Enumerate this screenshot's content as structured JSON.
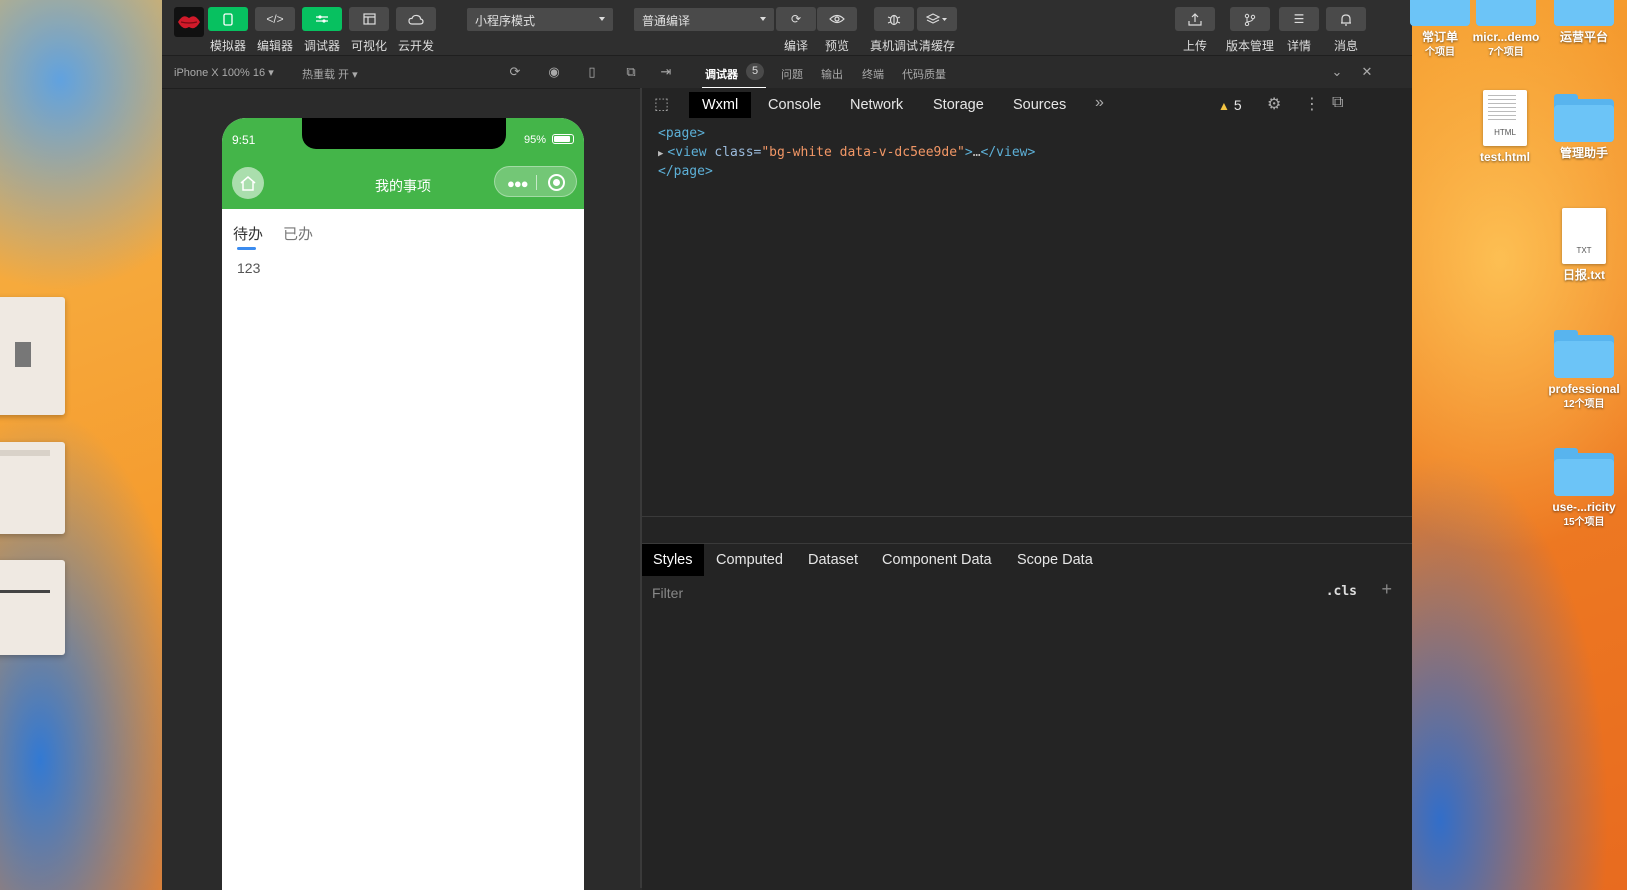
{
  "toolbar": {
    "buttons": [
      {
        "label": "模拟器",
        "icon": "phone-icon"
      },
      {
        "label": "编辑器",
        "icon": "code-icon"
      },
      {
        "label": "调试器",
        "icon": "debug-icon"
      },
      {
        "label": "可视化",
        "icon": "layout-icon"
      },
      {
        "label": "云开发",
        "icon": "cloud-icon"
      }
    ],
    "mode_select": "小程序模式",
    "compile_select": "普通编译",
    "actions": [
      {
        "label": "编译",
        "icon": "refresh-icon"
      },
      {
        "label": "预览",
        "icon": "eye-icon"
      },
      {
        "label": "真机调试",
        "icon": "bug-icon"
      },
      {
        "label": "清缓存",
        "icon": "layers-icon"
      }
    ],
    "right_actions": [
      {
        "label": "上传",
        "icon": "upload-icon"
      },
      {
        "label": "版本管理",
        "icon": "branch-icon"
      },
      {
        "label": "详情",
        "icon": "menu-icon"
      },
      {
        "label": "消息",
        "icon": "bell-icon"
      }
    ]
  },
  "subbar": {
    "device": "iPhone X 100% 16",
    "hot_reload": "热重载 开",
    "tabs": [
      "调试器",
      "问题",
      "输出",
      "终端",
      "代码质量"
    ],
    "debugger_count": "5"
  },
  "phone": {
    "time": "9:51",
    "battery": "95%",
    "title": "我的事项",
    "tabs": [
      "待办",
      "已办"
    ],
    "content": "123"
  },
  "devtools": {
    "tabs": [
      "Wxml",
      "Console",
      "Network",
      "Storage",
      "Sources"
    ],
    "more": "»",
    "warnings": "5",
    "wxml": {
      "open_tag": "<page>",
      "view_open": "<view",
      "attr_name": "class=",
      "attr_value": "\"bg-white data-v-dc5ee9de\"",
      "view_close_bracket": ">",
      "ellipsis": "…",
      "view_close": "</view>",
      "close_tag": "</page>"
    },
    "styles_tabs": [
      "Styles",
      "Computed",
      "Dataset",
      "Component Data",
      "Scope Data"
    ],
    "filter_placeholder": "Filter",
    "cls": ".cls",
    "plus": "+"
  },
  "desktop": {
    "icons": [
      {
        "name": "常订单",
        "sub": "个项目",
        "type": "folder"
      },
      {
        "name": "micr...demo",
        "sub": "7个项目",
        "type": "folder"
      },
      {
        "name": "运营平台",
        "sub": "",
        "type": "folder"
      },
      {
        "name": "test.html",
        "sub": "",
        "type": "file",
        "ext": "HTML"
      },
      {
        "name": "管理助手",
        "sub": "",
        "type": "folder"
      },
      {
        "name": "日报.txt",
        "sub": "",
        "type": "file",
        "ext": "TXT"
      },
      {
        "name": "professional",
        "sub": "12个项目",
        "type": "folder"
      },
      {
        "name": "use-...ricity",
        "sub": "15个项目",
        "type": "folder"
      }
    ]
  },
  "colors": {
    "green": "#07c160",
    "nav_green": "#44b549",
    "tab_accent": "#3a8bef",
    "ide_bg": "#2b2b2b"
  }
}
